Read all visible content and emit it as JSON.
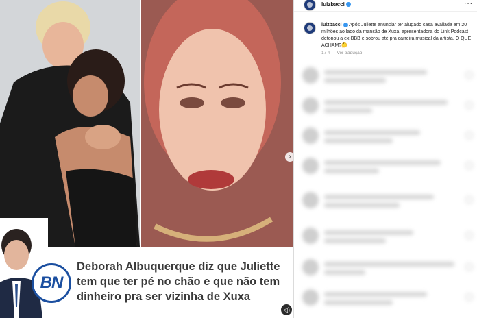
{
  "post": {
    "headline": "Deborah Albuquerque diz que Juliette tem que ter pé no chão e que não tem dinheiro pra ser vizinha de Xuxa",
    "logo_text": "BN"
  },
  "instagram": {
    "header_username": "luizbacci",
    "more_glyph": "···",
    "caption_username": "luizbacci",
    "caption_text": "Após Juliette anunciar ter alugado casa avaliada em 20 milhões ao lado da mansão de Xuxa, apresentadora do Link Podcast detonou a ex-BBB e sobrou até pra carreira musical da artista. O QUE ACHAM?🤔",
    "time": "17 h",
    "translate_label": "Ver tradução"
  },
  "colors": {
    "brand_blue": "#1b4fa0",
    "verified_blue": "#3897f0"
  }
}
